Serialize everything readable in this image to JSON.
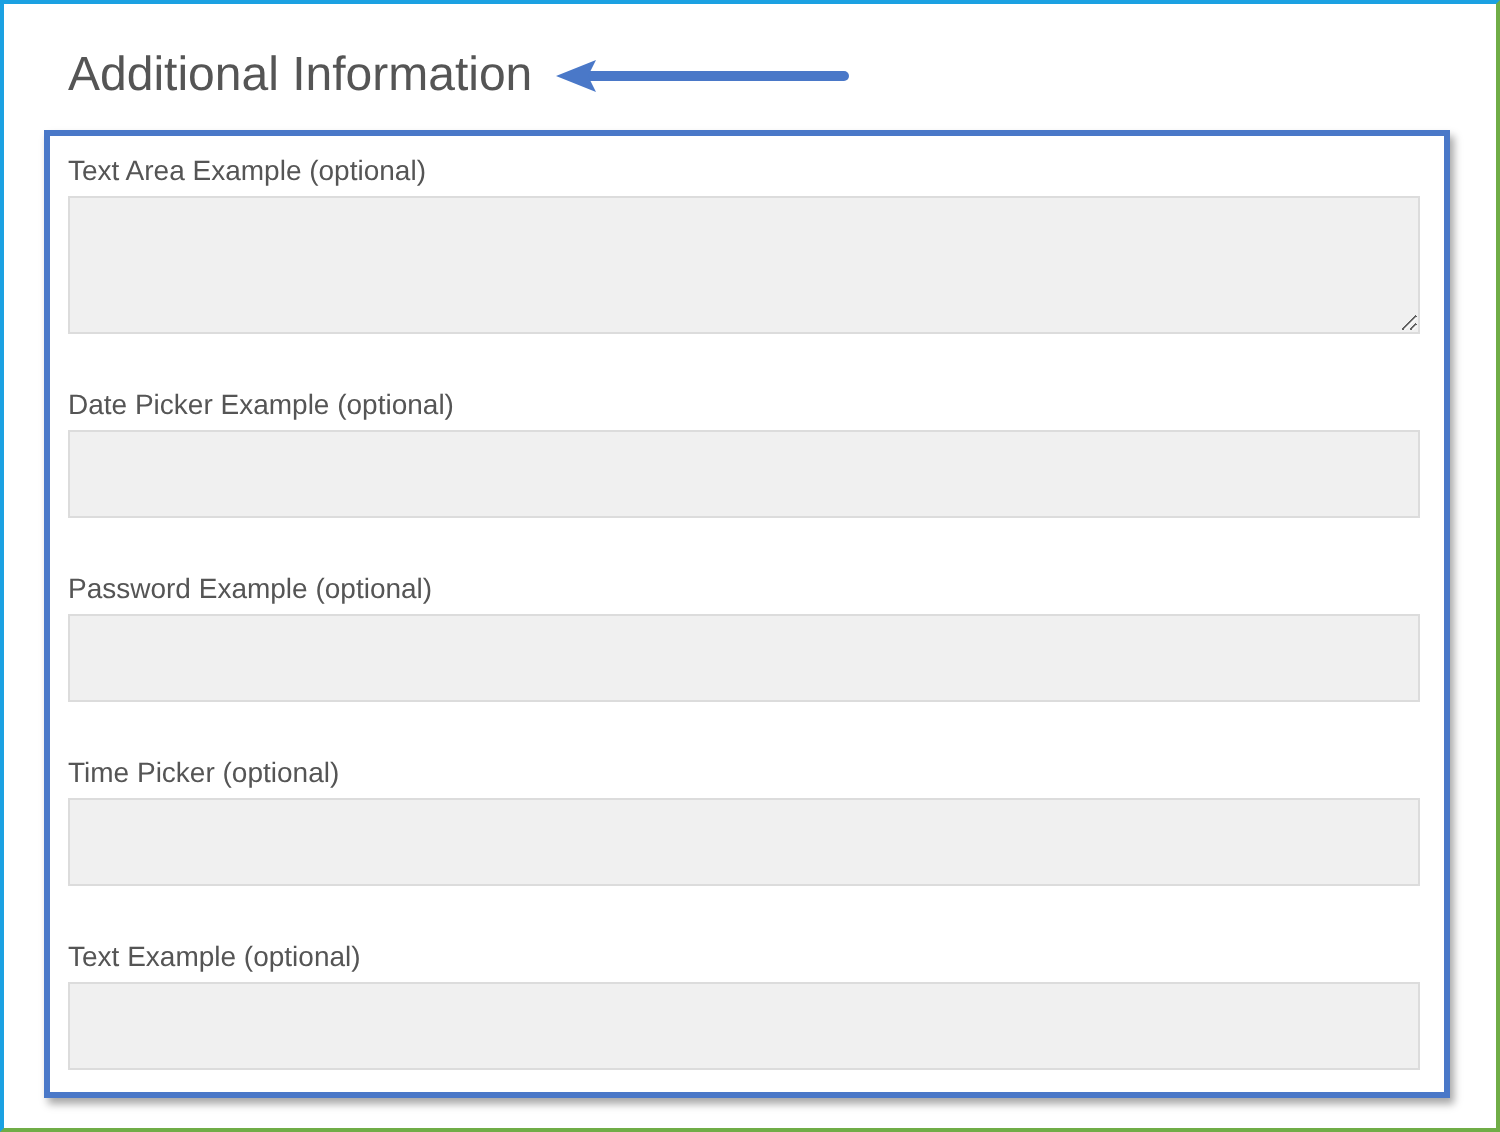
{
  "heading": "Additional Information",
  "fields": [
    {
      "kind": "textarea",
      "label": "Text Area Example (optional)"
    },
    {
      "kind": "text",
      "label": "Date Picker Example (optional)"
    },
    {
      "kind": "password",
      "label": "Password Example (optional)"
    },
    {
      "kind": "text",
      "label": "Time Picker (optional)"
    },
    {
      "kind": "text",
      "label": "Text Example (optional)"
    }
  ]
}
